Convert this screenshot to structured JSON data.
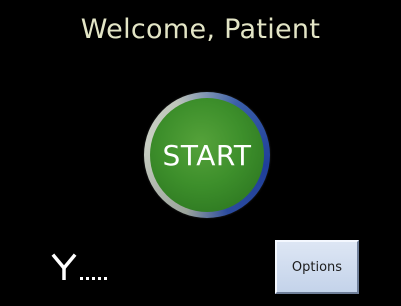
{
  "header": {
    "title": "Welcome, Patient"
  },
  "main": {
    "start_label": "START"
  },
  "footer": {
    "signal_icon": "antenna-signal-icon",
    "options_label": "Options"
  },
  "colors": {
    "background": "#000000",
    "title_text": "#e3e5c6",
    "start_green": "#3d8f2b",
    "options_bg": "#c4d3ea"
  }
}
